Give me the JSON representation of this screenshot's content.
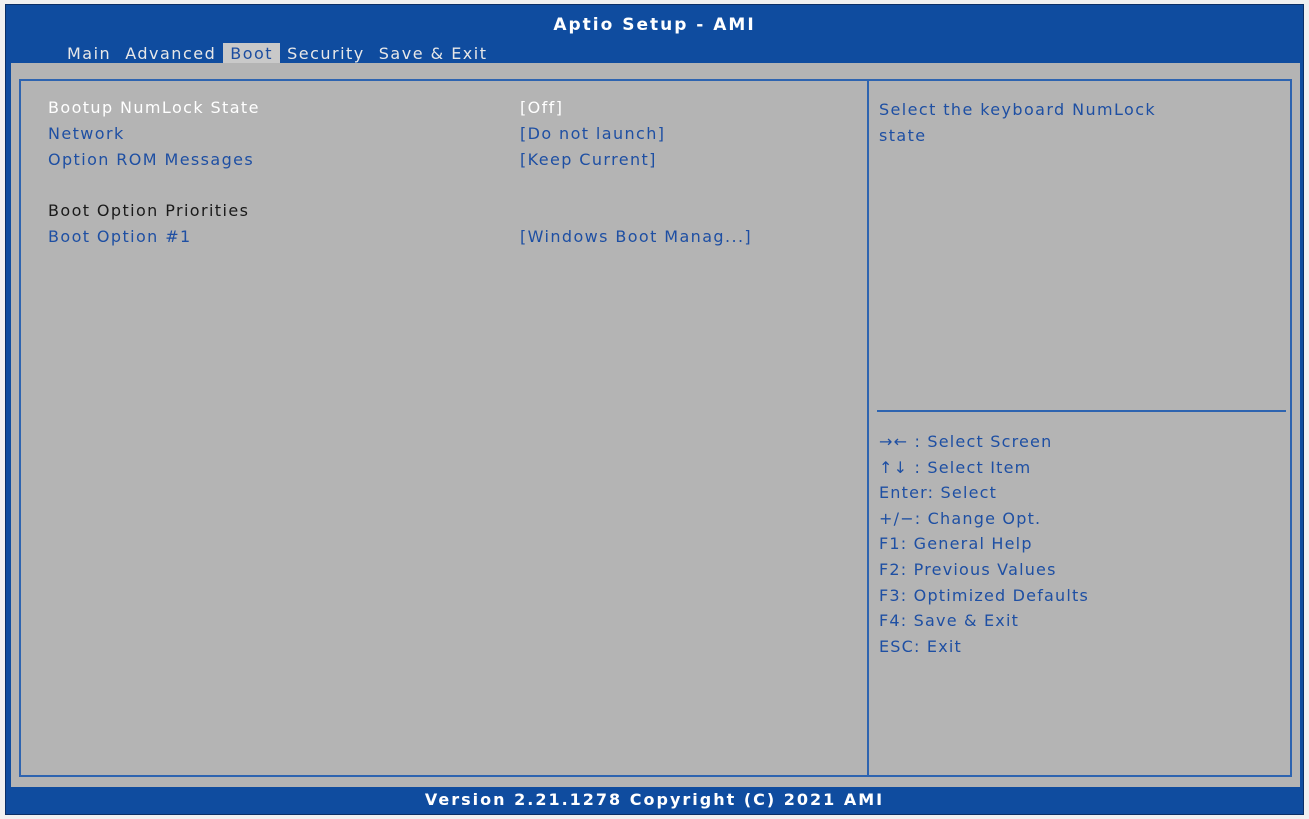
{
  "window": {
    "title": "Aptio Setup - AMI"
  },
  "tabs": [
    {
      "label": "Main"
    },
    {
      "label": "Advanced"
    },
    {
      "label": "Boot"
    },
    {
      "label": "Security"
    },
    {
      "label": "Save & Exit"
    }
  ],
  "active_tab": "Boot",
  "settings": [
    {
      "label": "Bootup NumLock State",
      "value": "[Off]"
    },
    {
      "label": "Network",
      "value": "[Do not launch]"
    },
    {
      "label": "Option ROM Messages",
      "value": "[Keep Current]"
    }
  ],
  "section": {
    "heading": "Boot Option Priorities"
  },
  "boot_options": [
    {
      "label": "Boot Option #1",
      "value": "[Windows Boot Manag...]"
    }
  ],
  "help": {
    "line1": "Select the keyboard NumLock",
    "line2": "state"
  },
  "keys": [
    {
      "icon": "left-right-arrows-icon",
      "text": "→← : Select Screen"
    },
    {
      "icon": "up-down-arrows-icon",
      "text": "↑↓ : Select Item"
    },
    {
      "text": "Enter: Select"
    },
    {
      "text": "+/−: Change Opt."
    },
    {
      "text": "F1: General Help"
    },
    {
      "text": "F2: Previous Values"
    },
    {
      "text": "F3: Optimized Defaults"
    },
    {
      "text": "F4: Save & Exit"
    },
    {
      "text": "ESC: Exit"
    }
  ],
  "footer": {
    "text": "Version 2.21.1278 Copyright (C) 2021 AMI"
  },
  "colors": {
    "header_blue": "#0f4c9f",
    "panel_gray": "#b4b4b4",
    "text_blue": "#1e4fa3",
    "selected_text": "#ffffff"
  }
}
